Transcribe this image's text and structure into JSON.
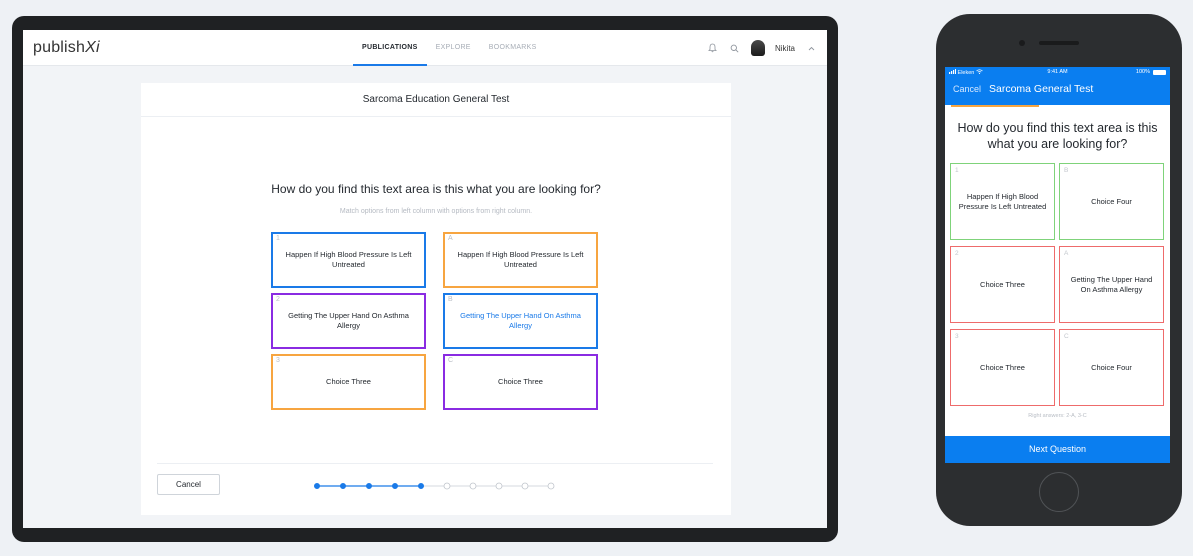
{
  "colors": {
    "accent_blue": "#1a7ae8",
    "purple": "#8a2be2",
    "orange": "#f7a540",
    "green": "#7fd37a",
    "red": "#ee6b6b"
  },
  "tablet": {
    "logo_main": "publish",
    "logo_tail": "Xi",
    "nav": [
      "PUBLICATIONS",
      "EXPLORE",
      "BOOKMARKS"
    ],
    "active_nav": "PUBLICATIONS",
    "icons": [
      "bell-icon",
      "search-icon"
    ],
    "user_name": "Nikita",
    "card_title": "Sarcoma Education General Test",
    "question": "How do you find this text area is this what you are looking for?",
    "hint": "Match options from left column with options from right column.",
    "left_options": [
      {
        "key": "1",
        "text": "Happen If High Blood Pressure Is Left Untreated",
        "color": "#1a7ae8"
      },
      {
        "key": "2",
        "text": "Getting The Upper Hand On Asthma Allergy",
        "color": "#8a2be2"
      },
      {
        "key": "3",
        "text": "Choice Three",
        "color": "#f7a540"
      }
    ],
    "right_options": [
      {
        "key": "A",
        "text": "Happen If High Blood Pressure Is Left Untreated",
        "color": "#f7a540"
      },
      {
        "key": "B",
        "text": "Getting The Upper Hand On Asthma Allergy",
        "color": "#1a7ae8",
        "text_color": "#1a7ae8"
      },
      {
        "key": "C",
        "text": "Choice Three",
        "color": "#8a2be2"
      }
    ],
    "cancel_label": "Cancel",
    "progress": {
      "completed": 5,
      "total": 10
    }
  },
  "phone": {
    "carrier": "Eleken",
    "time": "9:41 AM",
    "battery": "100%",
    "cancel_label": "Cancel",
    "title": "Sarcoma General Test",
    "question": "How do you find this text area is this what you are looking for?",
    "left_options": [
      {
        "key": "1",
        "text": "Happen If High Blood Pressure Is Left Untreated",
        "color": "#7fd37a"
      },
      {
        "key": "2",
        "text": "Choice Three",
        "color": "#ee6b6b"
      },
      {
        "key": "3",
        "text": "Choice Three",
        "color": "#ee6b6b"
      }
    ],
    "right_options": [
      {
        "key": "B",
        "text": "Choice Four",
        "color": "#7fd37a"
      },
      {
        "key": "A",
        "text": "Getting The Upper Hand On Asthma Allergy",
        "color": "#ee6b6b"
      },
      {
        "key": "C",
        "text": "Choice Four",
        "color": "#ee6b6b"
      }
    ],
    "right_answers": "Right answers: 2-A, 3-C",
    "next_label": "Next Question"
  }
}
